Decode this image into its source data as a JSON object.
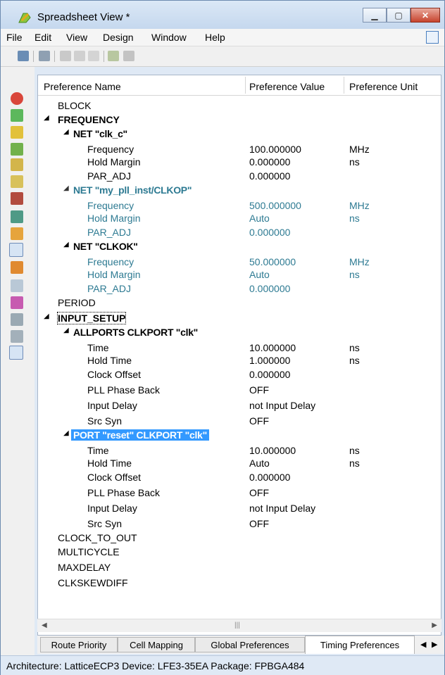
{
  "window": {
    "title": "Spreadsheet View *"
  },
  "menu": [
    "File",
    "Edit",
    "View",
    "Design",
    "Window",
    "Help"
  ],
  "columns": [
    "Preference Name",
    "Preference Value",
    "Preference Unit"
  ],
  "rows": [
    {
      "name": "BLOCK",
      "value": "",
      "unit": ""
    },
    {
      "name": "FREQUENCY",
      "value": "",
      "unit": ""
    },
    {
      "name": "NET \"clk_c\"",
      "value": "",
      "unit": ""
    },
    {
      "name": "Frequency",
      "value": "100.000000",
      "unit": "MHz"
    },
    {
      "name": "Hold Margin",
      "value": "0.000000",
      "unit": "ns"
    },
    {
      "name": "PAR_ADJ",
      "value": "0.000000",
      "unit": ""
    },
    {
      "name": "NET \"my_pll_inst/CLKOP\"",
      "value": "",
      "unit": ""
    },
    {
      "name": "Frequency",
      "value": "500.000000",
      "unit": "MHz"
    },
    {
      "name": "Hold Margin",
      "value": "Auto",
      "unit": "ns"
    },
    {
      "name": "PAR_ADJ",
      "value": "0.000000",
      "unit": ""
    },
    {
      "name": "NET \"CLKOK\"",
      "value": "",
      "unit": ""
    },
    {
      "name": "Frequency",
      "value": "50.000000",
      "unit": "MHz"
    },
    {
      "name": "Hold Margin",
      "value": "Auto",
      "unit": "ns"
    },
    {
      "name": "PAR_ADJ",
      "value": "0.000000",
      "unit": ""
    },
    {
      "name": "PERIOD",
      "value": "",
      "unit": ""
    },
    {
      "name": "INPUT_SETUP",
      "value": "",
      "unit": ""
    },
    {
      "name": "ALLPORTS CLKPORT \"clk\"",
      "value": "",
      "unit": ""
    },
    {
      "name": "Time",
      "value": "10.000000",
      "unit": "ns"
    },
    {
      "name": "Hold Time",
      "value": "1.000000",
      "unit": "ns"
    },
    {
      "name": "Clock Offset",
      "value": "0.000000",
      "unit": ""
    },
    {
      "name": "PLL Phase Back",
      "value": "OFF",
      "unit": ""
    },
    {
      "name": "Input Delay",
      "value": "not Input Delay",
      "unit": ""
    },
    {
      "name": "Src Syn",
      "value": "OFF",
      "unit": ""
    },
    {
      "name": "PORT \"reset\" CLKPORT \"clk\"",
      "value": "",
      "unit": ""
    },
    {
      "name": "Time",
      "value": "10.000000",
      "unit": "ns"
    },
    {
      "name": "Hold Time",
      "value": "Auto",
      "unit": "ns"
    },
    {
      "name": "Clock Offset",
      "value": "0.000000",
      "unit": ""
    },
    {
      "name": "PLL Phase Back",
      "value": "OFF",
      "unit": ""
    },
    {
      "name": "Input Delay",
      "value": "not Input Delay",
      "unit": ""
    },
    {
      "name": "Src Syn",
      "value": "OFF",
      "unit": ""
    },
    {
      "name": "CLOCK_TO_OUT",
      "value": "",
      "unit": ""
    },
    {
      "name": "MULTICYCLE",
      "value": "",
      "unit": ""
    },
    {
      "name": "MAXDELAY",
      "value": "",
      "unit": ""
    },
    {
      "name": "CLKSKEWDIFF",
      "value": "",
      "unit": ""
    }
  ],
  "tabs": [
    "Route Priority",
    "Cell Mapping",
    "Global Preferences",
    "Timing Preferences"
  ],
  "status": "Architecture: LatticeECP3  Device: LFE3-35EA  Package: FPBGA484",
  "colors": {
    "selection": "#3399ff",
    "teal_text": "#2d7a92",
    "title_bar": "#c5d8ee",
    "close_button": "#c7442d"
  },
  "icons": [
    "app-icon",
    "save-icon",
    "print-icon",
    "cut-icon",
    "copy-icon",
    "paste-icon",
    "import-icon",
    "export-icon"
  ]
}
